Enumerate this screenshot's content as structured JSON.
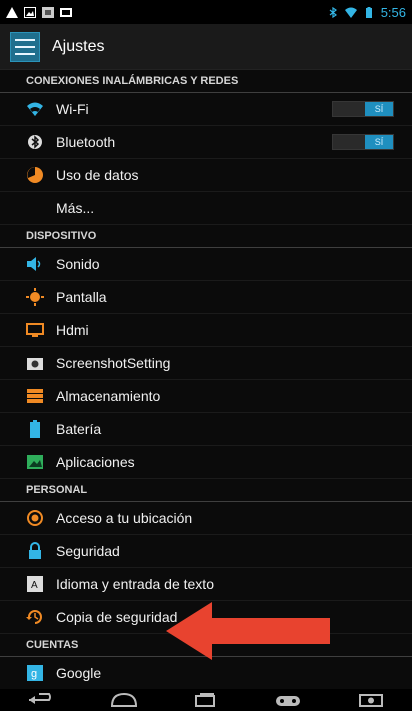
{
  "status_bar": {
    "time": "5:56"
  },
  "action_bar": {
    "title": "Ajustes"
  },
  "sections": [
    {
      "header": "CONEXIONES INALÁMBRICAS Y REDES",
      "items": [
        {
          "label": "Wi-Fi",
          "icon": "wifi-icon",
          "toggle": "SÍ"
        },
        {
          "label": "Bluetooth",
          "icon": "bluetooth-icon",
          "toggle": "SÍ"
        },
        {
          "label": "Uso de datos",
          "icon": "data-usage-icon"
        },
        {
          "label": "Más...",
          "icon": ""
        }
      ]
    },
    {
      "header": "DISPOSITIVO",
      "items": [
        {
          "label": "Sonido",
          "icon": "sound-icon"
        },
        {
          "label": "Pantalla",
          "icon": "display-icon"
        },
        {
          "label": "Hdmi",
          "icon": "hdmi-icon"
        },
        {
          "label": "ScreenshotSetting",
          "icon": "camera-icon"
        },
        {
          "label": "Almacenamiento",
          "icon": "storage-icon"
        },
        {
          "label": "Batería",
          "icon": "battery-icon"
        },
        {
          "label": "Aplicaciones",
          "icon": "apps-icon"
        }
      ]
    },
    {
      "header": "PERSONAL",
      "items": [
        {
          "label": "Acceso a tu ubicación",
          "icon": "location-icon"
        },
        {
          "label": "Seguridad",
          "icon": "lock-icon"
        },
        {
          "label": "Idioma y entrada de texto",
          "icon": "language-icon"
        },
        {
          "label": "Copia de seguridad",
          "icon": "backup-icon"
        }
      ]
    },
    {
      "header": "CUENTAS",
      "items": [
        {
          "label": "Google",
          "icon": "google-icon"
        }
      ]
    }
  ],
  "colors": {
    "accent": "#33b5e5",
    "arrow": "#e8432f"
  }
}
